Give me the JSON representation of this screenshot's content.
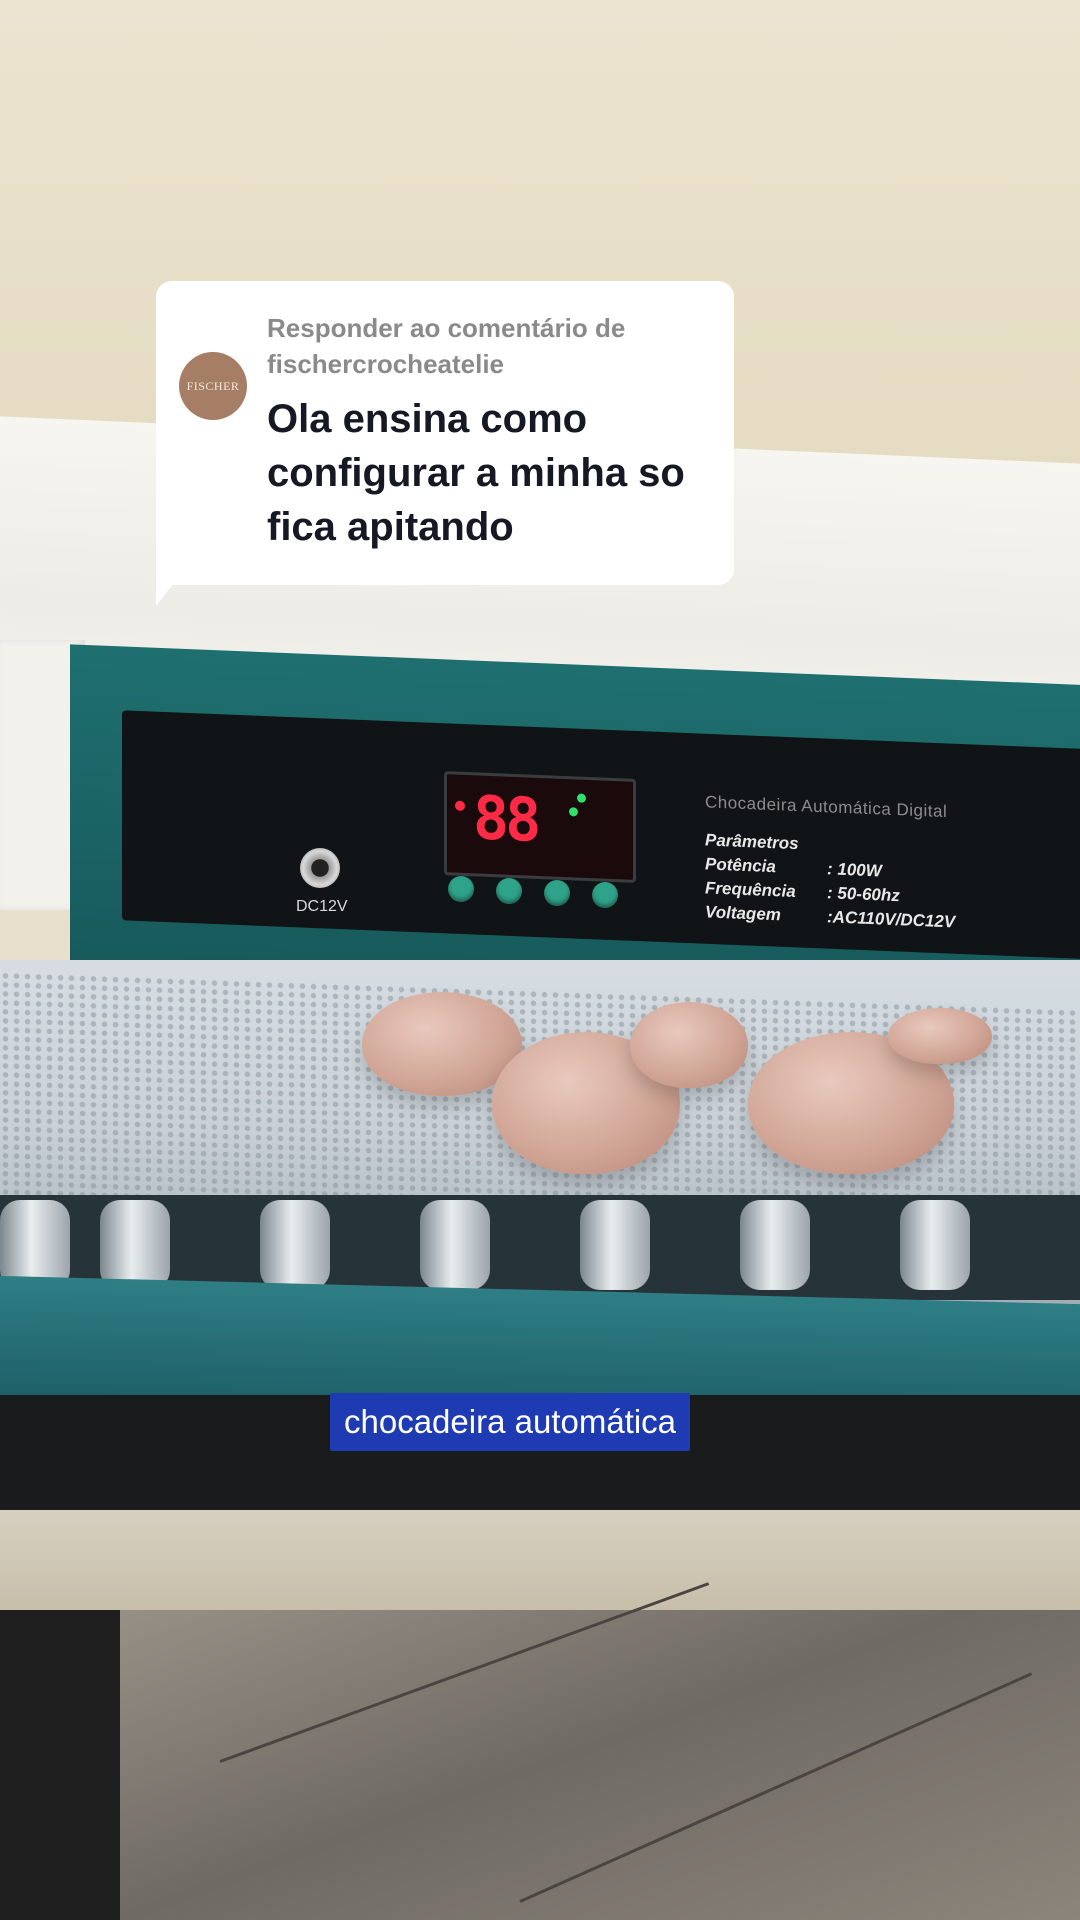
{
  "reply": {
    "header": "Responder ao comentário de fischercrocheatelie",
    "avatar_text": "FISCHER",
    "comment": "Ola ensina como configurar a minha so fica apitando"
  },
  "caption": "chocadeira automática",
  "device": {
    "dc_label": "DC12V",
    "display_digits": "88",
    "brand_text": "Chocadeira Automática Digital",
    "params_title": "Parâmetros",
    "specs": [
      {
        "label": "Potência",
        "value": ": 100W"
      },
      {
        "label": "Frequência",
        "value": ": 50-60hz"
      },
      {
        "label": "Voltagem",
        "value": ":AC110V/DC12V"
      }
    ]
  }
}
